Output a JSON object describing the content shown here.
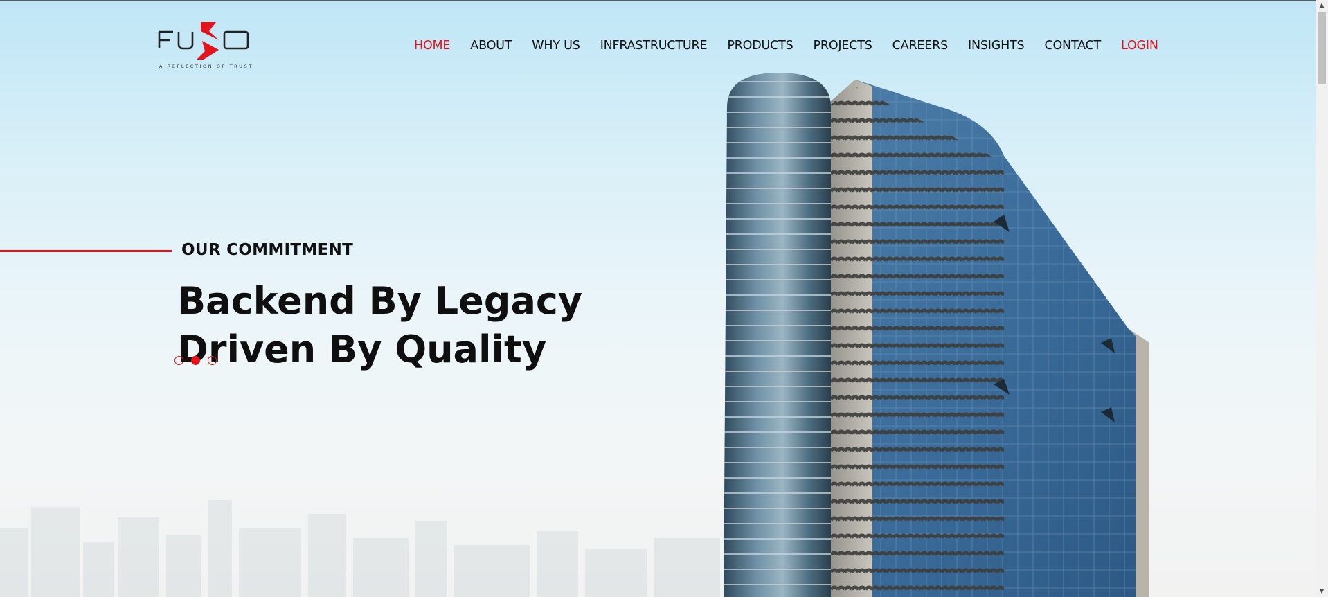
{
  "brand": {
    "name": "FUSO",
    "tagline": "A REFLECTION OF TRUST",
    "accent_color": "#e3141c"
  },
  "nav": {
    "items": [
      {
        "label": "HOME"
      },
      {
        "label": "ABOUT"
      },
      {
        "label": "WHY US"
      },
      {
        "label": "INFRASTRUCTURE"
      },
      {
        "label": "PRODUCTS"
      },
      {
        "label": "PROJECTS"
      },
      {
        "label": "CAREERS"
      },
      {
        "label": "INSIGHTS"
      },
      {
        "label": "CONTACT"
      },
      {
        "label": "LOGIN"
      }
    ],
    "active_index": 0
  },
  "hero": {
    "eyebrow": "OUR COMMITMENT",
    "headline_line1": "Backend By Legacy",
    "headline_line2": "Driven By Quality",
    "slides_count": 3,
    "active_slide": 2,
    "image": "office-tower"
  },
  "scrollbar": {
    "up_icon": "arrow-up-icon",
    "down_icon": "arrow-down-icon"
  }
}
